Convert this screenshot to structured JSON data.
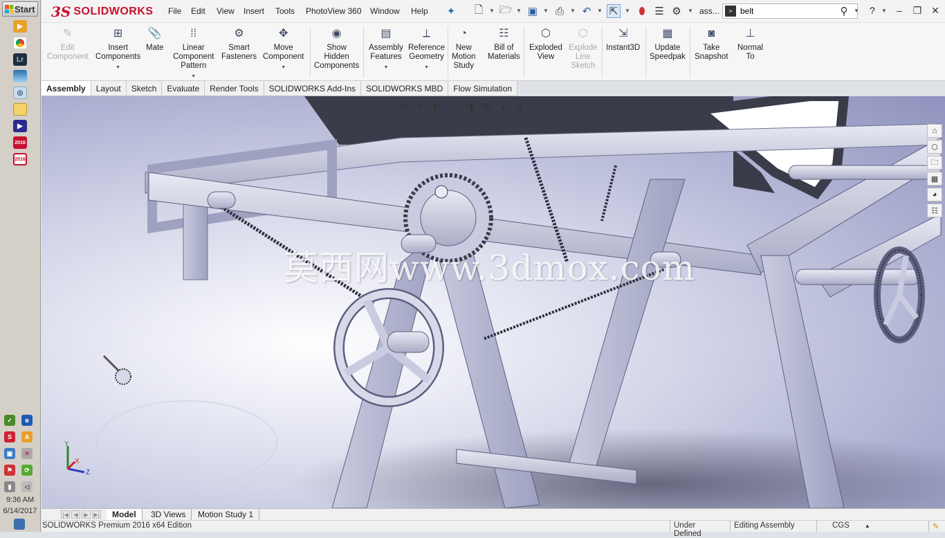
{
  "taskbar": {
    "start_label": "Start",
    "clock_time": "9:36 AM",
    "clock_date": "6/14/2017"
  },
  "app": {
    "logo_ds": "3S",
    "logo_text": "SOLIDWORKS",
    "menu": [
      "File",
      "Edit",
      "View",
      "Insert",
      "Tools",
      "PhotoView 360",
      "Window",
      "Help"
    ],
    "doc_abbrev": "ass...",
    "search_value": "belt",
    "help_label": "?"
  },
  "ribbon": {
    "buttons": [
      {
        "label": "Edit\nComponent",
        "icon": "edit-component-icon",
        "disabled": true
      },
      {
        "label": "Insert\nComponents",
        "icon": "insert-components-icon",
        "disabled": false
      },
      {
        "label": "Mate",
        "icon": "mate-icon",
        "disabled": false
      },
      {
        "label": "Linear\nComponent\nPattern",
        "icon": "linear-pattern-icon",
        "disabled": false
      },
      {
        "label": "Smart\nFasteners",
        "icon": "smart-fasteners-icon",
        "disabled": false
      },
      {
        "label": "Move\nComponent",
        "icon": "move-component-icon",
        "disabled": false
      },
      {
        "label": "Show\nHidden\nComponents",
        "icon": "show-hidden-icon",
        "disabled": false
      },
      {
        "label": "Assembly\nFeatures",
        "icon": "assembly-features-icon",
        "disabled": false
      },
      {
        "label": "Reference\nGeometry",
        "icon": "reference-geometry-icon",
        "disabled": false
      },
      {
        "label": "New\nMotion\nStudy",
        "icon": "motion-study-icon",
        "disabled": false
      },
      {
        "label": "Bill of\nMaterials",
        "icon": "bom-icon",
        "disabled": false
      },
      {
        "label": "Exploded\nView",
        "icon": "exploded-view-icon",
        "disabled": false
      },
      {
        "label": "Explode\nLine\nSketch",
        "icon": "explode-line-icon",
        "disabled": true
      },
      {
        "label": "Instant3D",
        "icon": "instant3d-icon",
        "disabled": false
      },
      {
        "label": "Update\nSpeedpak",
        "icon": "speedpak-icon",
        "disabled": false
      },
      {
        "label": "Take\nSnapshot",
        "icon": "snapshot-icon",
        "disabled": false
      },
      {
        "label": "Normal\nTo",
        "icon": "normal-to-icon",
        "disabled": false
      }
    ]
  },
  "tabs": [
    "Assembly",
    "Layout",
    "Sketch",
    "Evaluate",
    "Render Tools",
    "SOLIDWORKS Add-Ins",
    "SOLIDWORKS MBD",
    "Flow Simulation"
  ],
  "active_tab": "Assembly",
  "viewport": {
    "watermark": "莫西网www.3dmox.com",
    "triad_x": "X",
    "triad_y": "Y",
    "triad_z": "Z"
  },
  "model_tabs": [
    "Model",
    "3D Views",
    "Motion Study 1"
  ],
  "status": {
    "product": "SOLIDWORKS Premium 2016 x64 Edition",
    "definition": "Under Defined",
    "mode": "Editing Assembly",
    "units": "CGS"
  },
  "colors": {
    "brand_red": "#c8102e",
    "viewport_top": "#8f92bd",
    "frame_metal": "#b9bcd3"
  }
}
